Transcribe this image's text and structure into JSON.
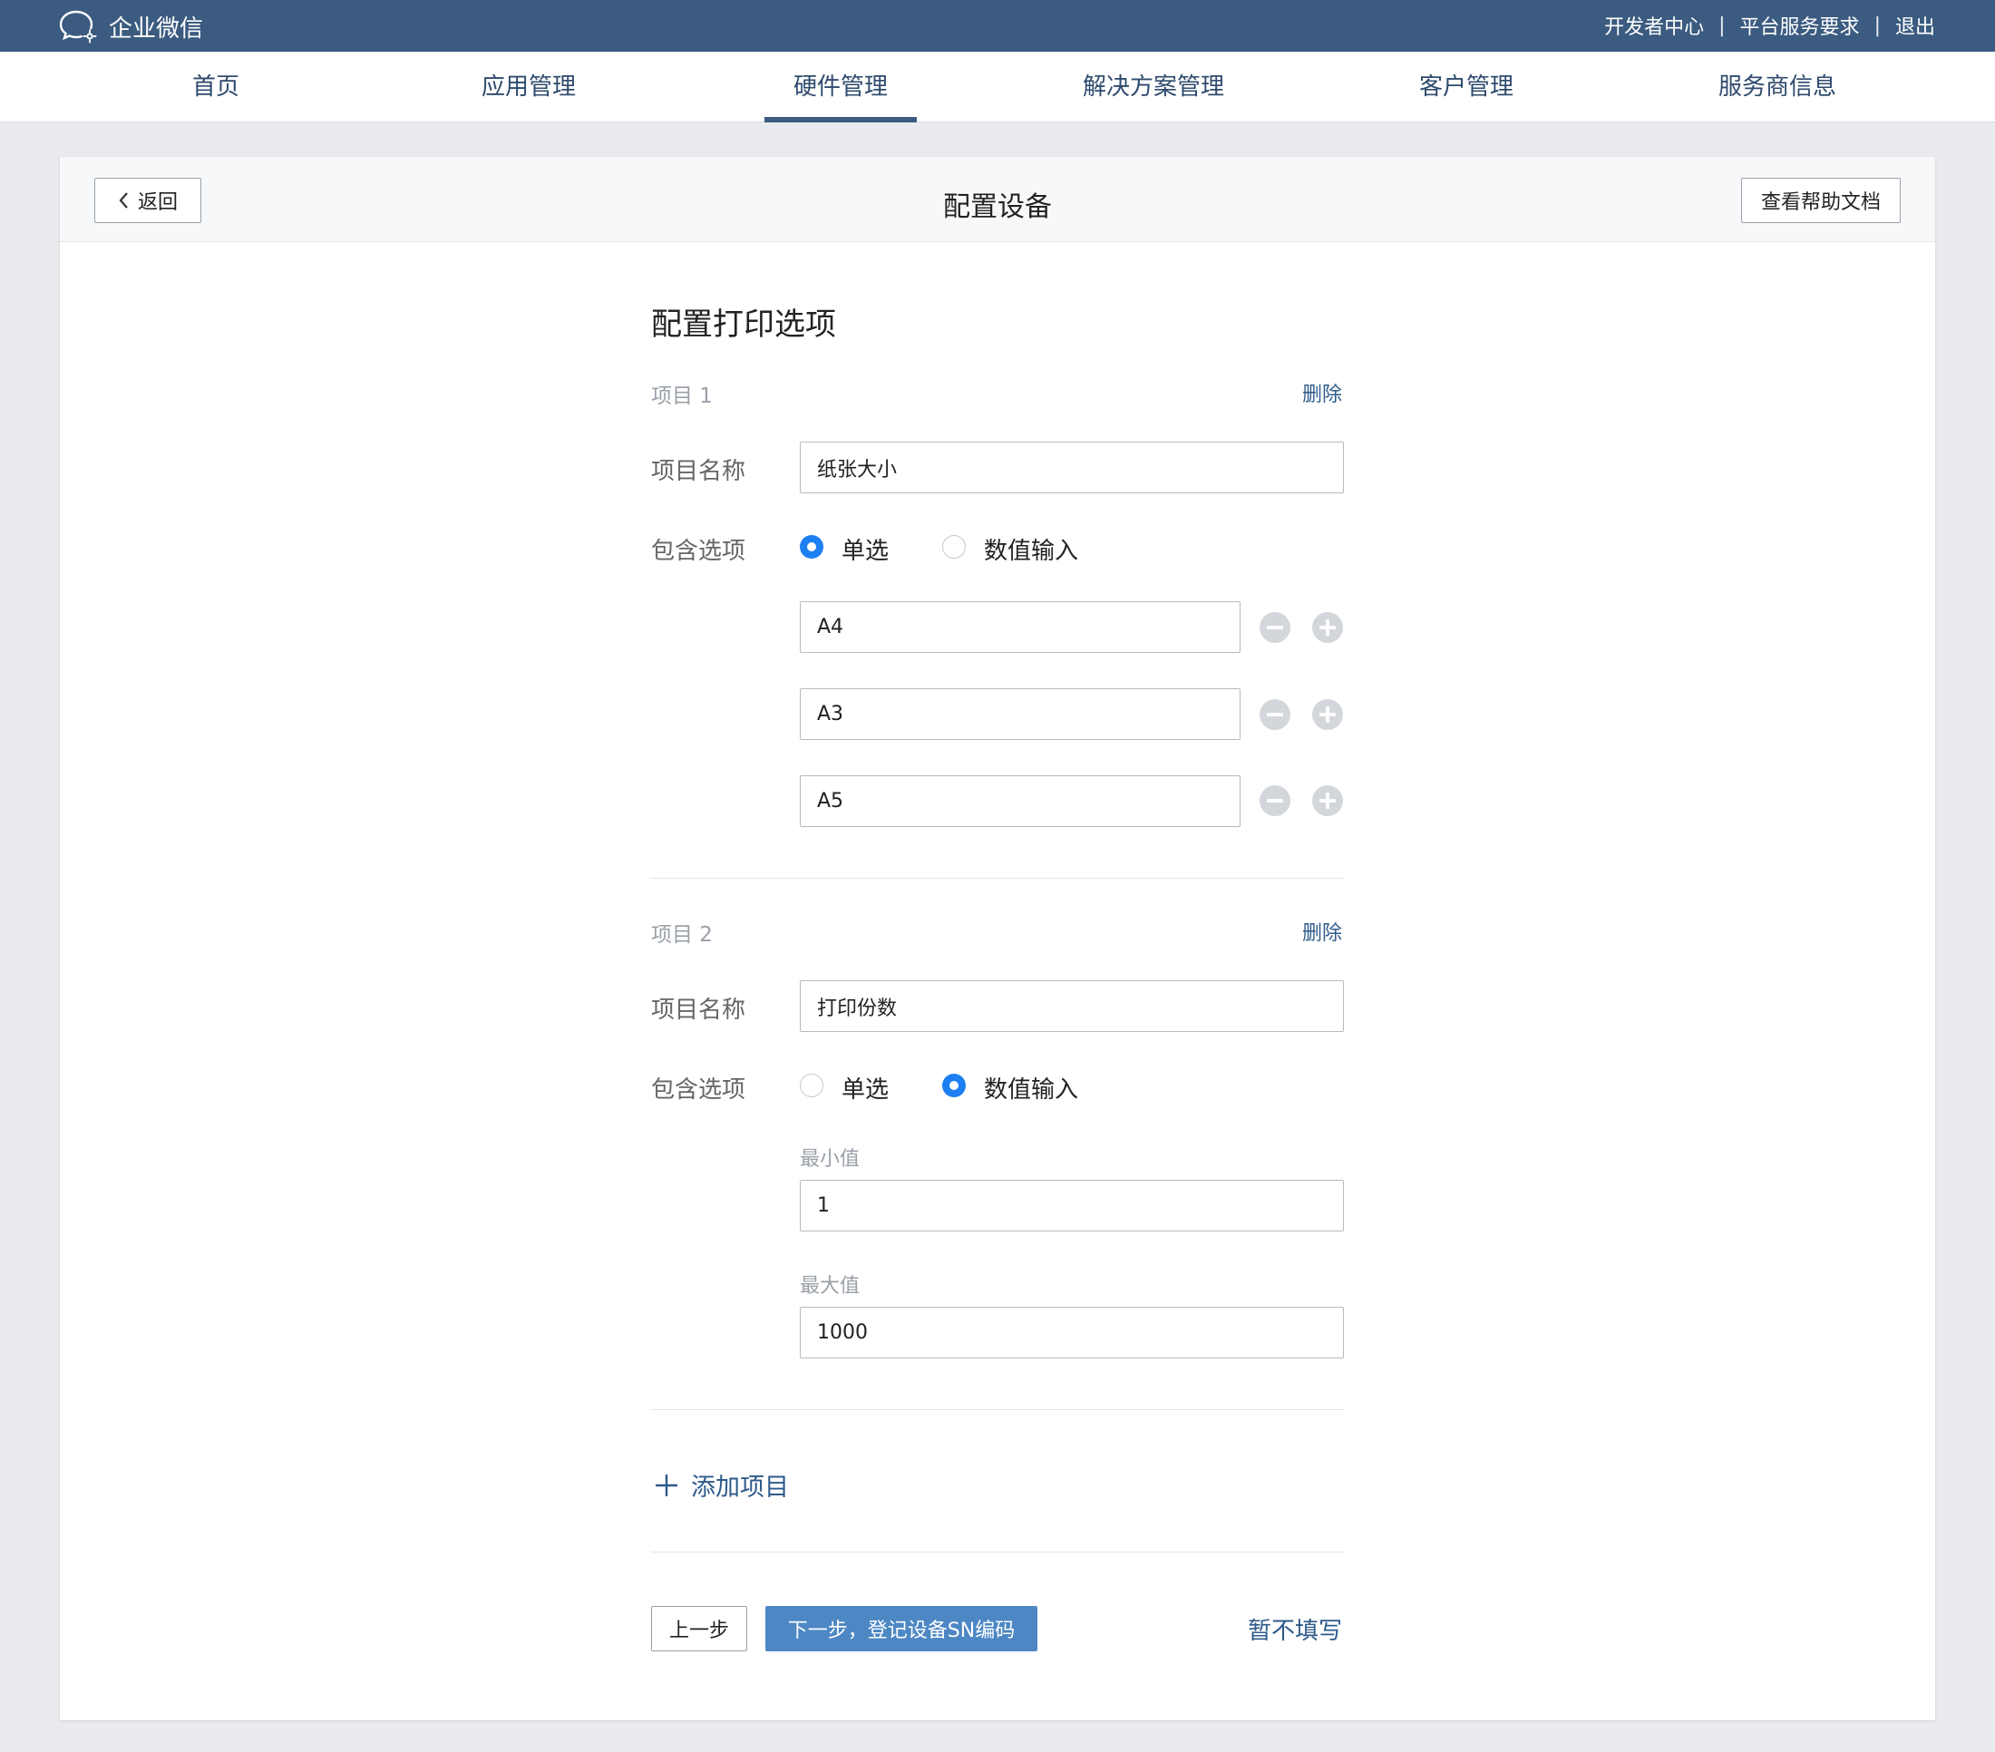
{
  "topbar": {
    "brand": "企业微信",
    "links": [
      "开发者中心",
      "平台服务要求",
      "退出"
    ],
    "separator": "|"
  },
  "nav": {
    "items": [
      "首页",
      "应用管理",
      "硬件管理",
      "解决方案管理",
      "客户管理",
      "服务商信息"
    ],
    "active": "硬件管理"
  },
  "header": {
    "back_label": "返回",
    "title": "配置设备",
    "help_label": "查看帮助文档"
  },
  "form": {
    "section_title": "配置打印选项",
    "name_label": "项目名称",
    "options_label": "包含选项",
    "radio_single": "单选",
    "radio_numeric": "数值输入",
    "delete_label": "删除",
    "item1": {
      "label": "项目 1",
      "name_value": "纸张大小",
      "selected": "单选",
      "options": [
        "A4",
        "A3",
        "A5"
      ]
    },
    "item2": {
      "label": "项目 2",
      "name_value": "打印份数",
      "selected": "数值输入",
      "min_label": "最小值",
      "min_value": "1",
      "max_label": "最大值",
      "max_value": "1000"
    },
    "add_item_label": "添加项目",
    "prev_label": "上一步",
    "next_label": "下一步，登记设备SN编码",
    "skip_label": "暂不填写"
  },
  "colors": {
    "topbar_bg": "#3b5b80",
    "radio_checked": "#1d7ff2",
    "primary_button": "#4d87c4",
    "link": "#2e5a8a"
  }
}
